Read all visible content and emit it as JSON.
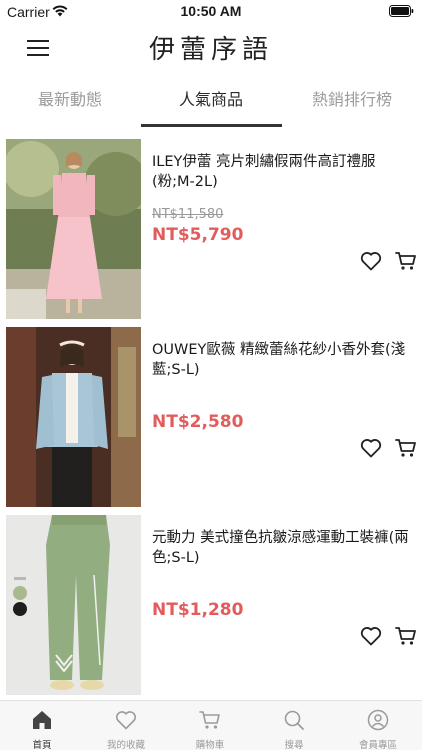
{
  "status_bar": {
    "carrier": "Carrier",
    "time": "10:50 AM"
  },
  "header": {
    "title": "伊蕾序語"
  },
  "tabs": [
    {
      "label": "最新動態",
      "active": false
    },
    {
      "label": "人氣商品",
      "active": true
    },
    {
      "label": "熱銷排行榜",
      "active": false
    }
  ],
  "products": [
    {
      "name": "ILEY伊蕾 亮片刺繡假兩件高訂禮服(粉;M-2L)",
      "original_price": "NT$11,580",
      "price": "NT$5,790",
      "image": "model in pink sequin dress"
    },
    {
      "name": "OUWEY歐薇 精緻蕾絲花紗小香外套(淺藍;S-L)",
      "original_price": "",
      "price": "NT$2,580",
      "image": "model in light blue lace jacket"
    },
    {
      "name": "元動力 美式撞色抗皺涼感運動工裝褲(兩色;S-L)",
      "original_price": "",
      "price": "NT$1,280",
      "image": "green cargo pants with color swatches"
    }
  ],
  "tab_bar": [
    {
      "label": "首頁",
      "icon": "home-icon",
      "active": true
    },
    {
      "label": "我的收藏",
      "icon": "heart-icon",
      "active": false
    },
    {
      "label": "購物車",
      "icon": "cart-icon",
      "active": false
    },
    {
      "label": "搜尋",
      "icon": "search-icon",
      "active": false
    },
    {
      "label": "會員專區",
      "icon": "user-icon",
      "active": false
    }
  ],
  "colors": {
    "sale_price": "#e35c5c",
    "active_tab": "#333333",
    "inactive": "#9b9b9b"
  }
}
